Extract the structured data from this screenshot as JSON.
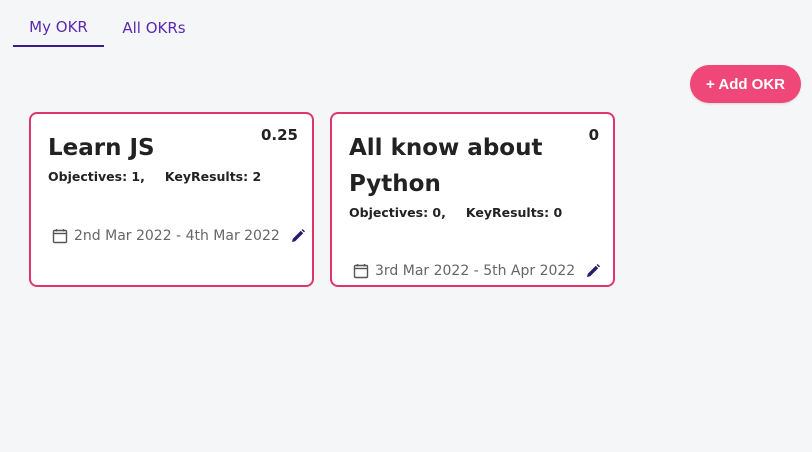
{
  "tabs": [
    {
      "label": "My OKR",
      "active": true
    },
    {
      "label": "All OKRs",
      "active": false
    }
  ],
  "add_button_label": "+ Add OKR",
  "cards": [
    {
      "score": "0.25",
      "title": "Learn JS",
      "objectives": "Objectives: 1,",
      "key_results": "KeyResults: 2",
      "dates": "2nd Mar 2022 - 4th Mar 2022"
    },
    {
      "score": "0",
      "title": "All know about Python",
      "objectives": "Objectives: 0,",
      "key_results": "KeyResults: 0",
      "dates": "3rd Mar 2022 - 5th Apr 2022"
    }
  ],
  "colors": {
    "accent": "#ef4777",
    "card_border": "#e0356a",
    "tab_text": "#5a2bb0",
    "edit_icon": "#2a1a6e"
  },
  "icons": {
    "date": "calendar-icon",
    "edit": "pencil-icon"
  }
}
